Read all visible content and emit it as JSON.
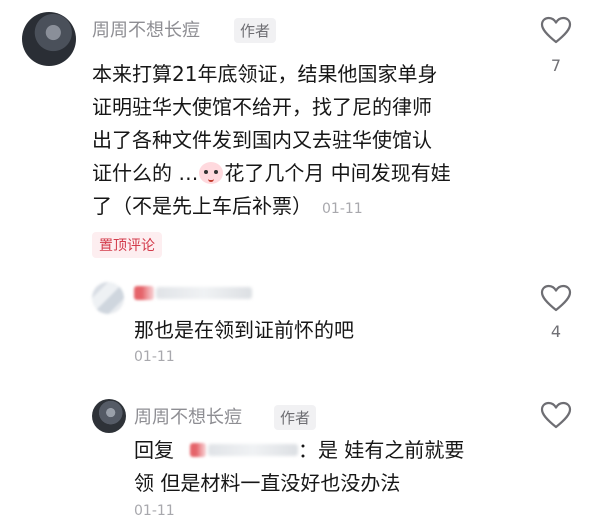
{
  "main_comment": {
    "username": "周周不想长痘",
    "author_tag": "作者",
    "lines": [
      "本来打算21年底领证，结果他国家单身",
      "证明驻华大使馆不给开，找了尼的律师",
      "出了各种文件发到国内又去驻华使馆认",
      "证什么的 …",
      "花了几个月 中间发现有娃",
      "了（不是先上车后补票）"
    ],
    "time": "01-11",
    "likes": "7",
    "pinned_label": "置顶评论"
  },
  "reply1": {
    "text": "那也是在领到证前怀的吧",
    "time": "01-11",
    "likes": "4"
  },
  "reply2": {
    "username": "周周不想长痘",
    "author_tag": "作者",
    "reply_prefix": "回复",
    "after_mention": "：是 娃有之前就要",
    "line2": "领 但是材料一直没好也没办法",
    "time": "01-11"
  },
  "icons": {
    "like": "heart-outline-icon",
    "emoji": "crying-face-emoji-icon"
  },
  "colors": {
    "pinned_text": "#d33a4a",
    "pinned_bg": "#fdeef0",
    "username": "#8e8e93"
  }
}
